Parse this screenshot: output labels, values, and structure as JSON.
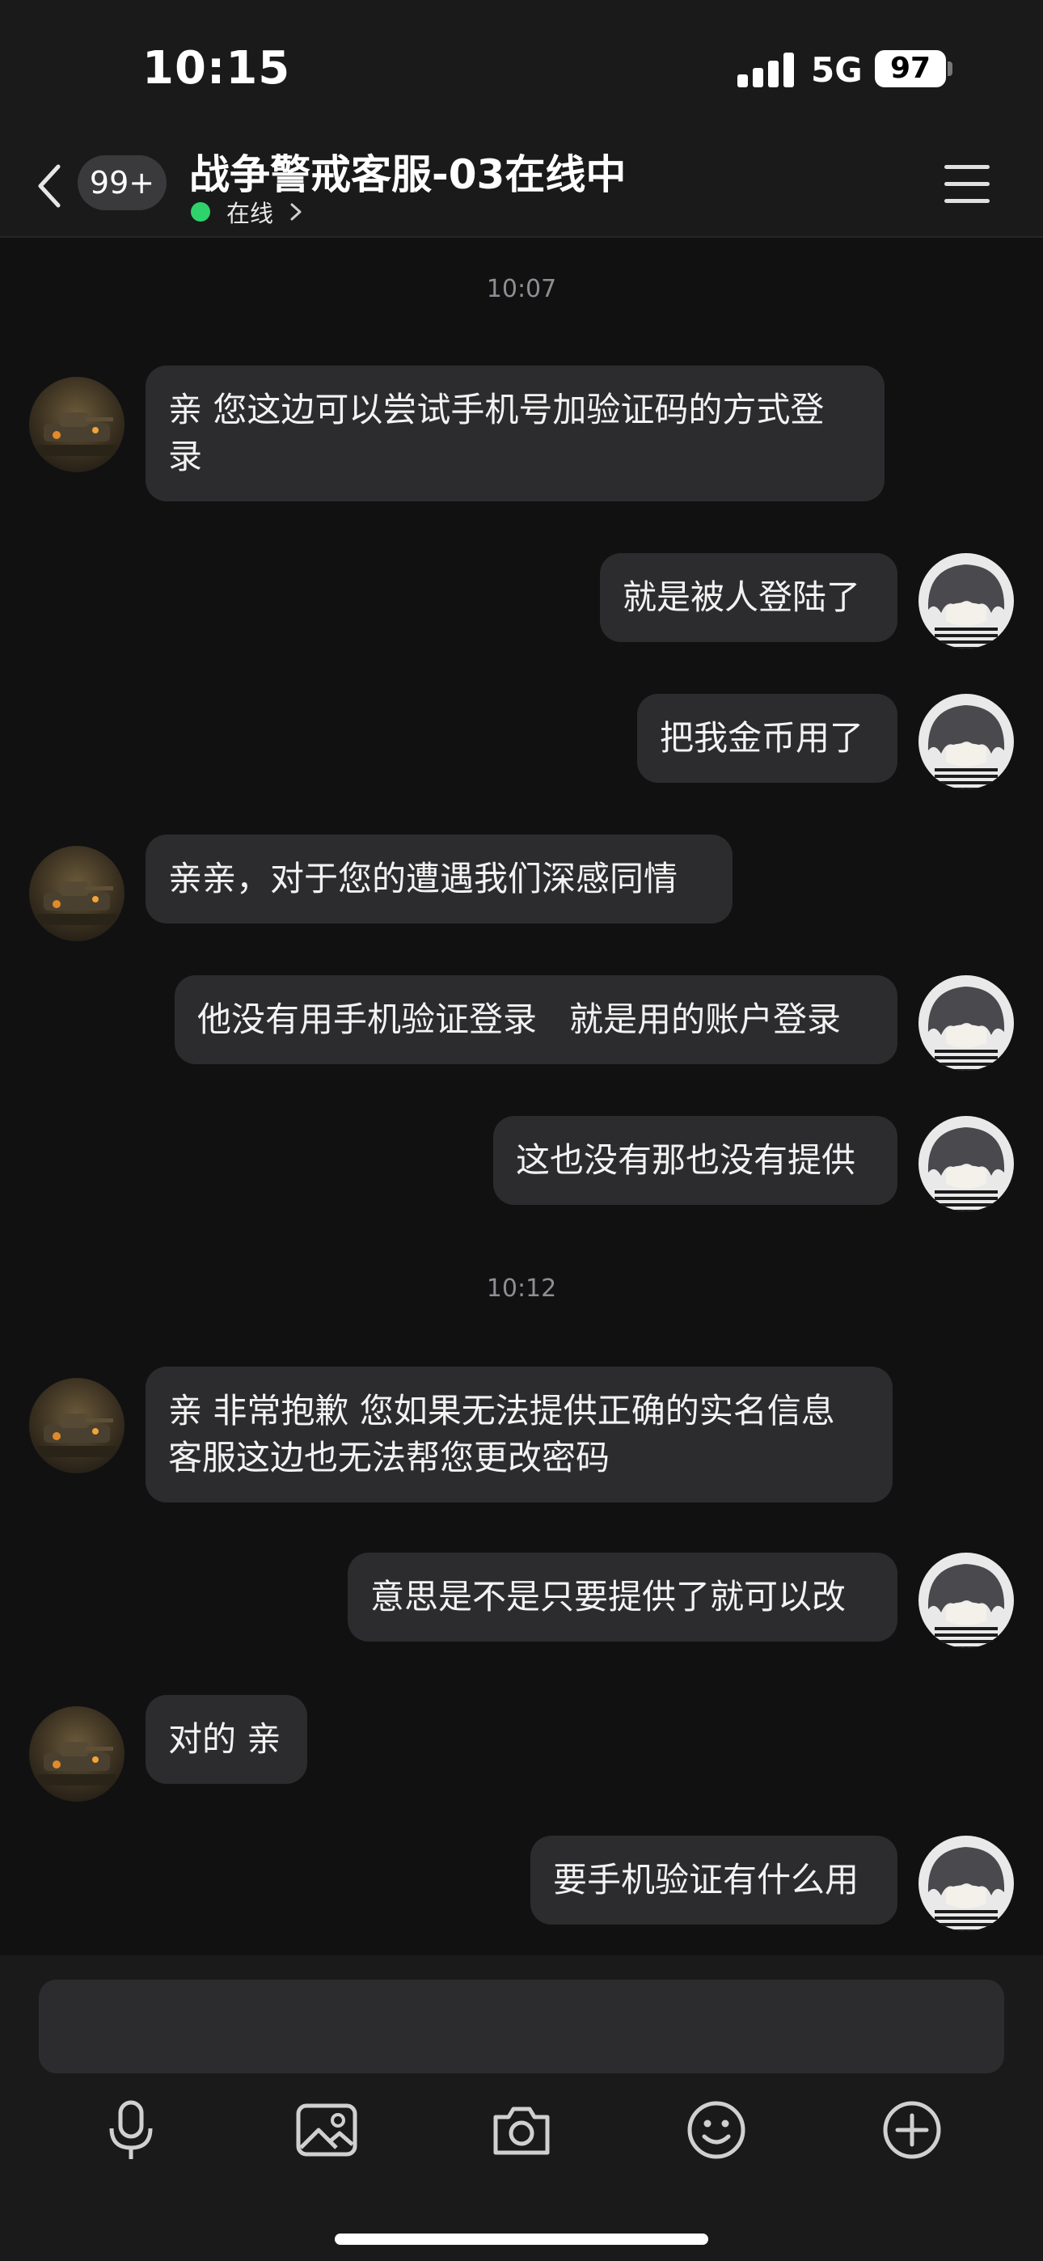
{
  "status": {
    "time": "10:15",
    "network": "5G",
    "battery": "97"
  },
  "header": {
    "unread_badge": "99+",
    "title": "战争警戒客服-03在线中",
    "status_text": "在线"
  },
  "messages": [
    {
      "type": "time",
      "text": "10:07"
    },
    {
      "type": "msg",
      "side": "left",
      "text": "亲 您这边可以尝试手机号加验证码的方式登\n录"
    },
    {
      "type": "msg",
      "side": "right",
      "text": "就是被人登陆了"
    },
    {
      "type": "msg",
      "side": "right",
      "text": "把我金币用了"
    },
    {
      "type": "msg",
      "side": "left",
      "text": "亲亲，对于您的遭遇我们深感同情"
    },
    {
      "type": "msg",
      "side": "right",
      "text": "他没有用手机验证登录   就是用的账户登录"
    },
    {
      "type": "msg",
      "side": "right",
      "text": "这也没有那也没有提供"
    },
    {
      "type": "time",
      "text": "10:12"
    },
    {
      "type": "msg",
      "side": "left",
      "text": "亲 非常抱歉 您如果无法提供正确的实名信息\n客服这边也无法帮您更改密码"
    },
    {
      "type": "msg",
      "side": "right",
      "text": "意思是不是只要提供了就可以改"
    },
    {
      "type": "msg",
      "side": "left",
      "text": "对的 亲"
    },
    {
      "type": "msg",
      "side": "right",
      "text": "要手机验证有什么用"
    }
  ],
  "toolbar": [
    "microphone-icon",
    "image-icon",
    "camera-icon",
    "emoji-icon",
    "plus-icon"
  ]
}
